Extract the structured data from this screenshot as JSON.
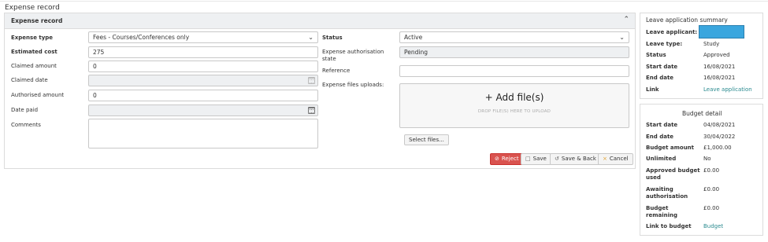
{
  "page": {
    "title": "Expense record"
  },
  "panel": {
    "title": "Expense record",
    "collapse_icon": "chevron-up-icon"
  },
  "form": {
    "expense_type": {
      "label": "Expense type",
      "value": "Fees - Courses/Conferences only"
    },
    "estimated_cost": {
      "label": "Estimated cost",
      "value": "275"
    },
    "claimed_amount": {
      "label": "Claimed amount",
      "value": "0"
    },
    "claimed_date": {
      "label": "Claimed date",
      "value": ""
    },
    "authorised_amount": {
      "label": "Authorised amount",
      "value": "0"
    },
    "date_paid": {
      "label": "Date paid",
      "value": ""
    },
    "comments": {
      "label": "Comments",
      "value": ""
    },
    "status": {
      "label": "Status",
      "value": "Active"
    },
    "auth_state": {
      "label_line1": "Expense authorisation",
      "label_line2": "state",
      "value": "Pending"
    },
    "reference": {
      "label": "Reference",
      "value": ""
    },
    "uploads": {
      "label": "Expense files uploads:",
      "add_text": "+ Add file(s)",
      "drop_hint": "DROP FILE(S) HERE TO UPLOAD",
      "select_button": "Select files..."
    }
  },
  "actions": {
    "reject": "Reject",
    "save": "Save",
    "save_back": "Save & Back",
    "cancel": "Cancel"
  },
  "leave_summary": {
    "title": "Leave application summary",
    "rows": [
      {
        "label": "Leave applicant:",
        "value": ""
      },
      {
        "label": "Leave type:",
        "value": "Study"
      },
      {
        "label": "Status",
        "value": "Approved"
      },
      {
        "label": "Start date",
        "value": "16/08/2021"
      },
      {
        "label": "End date",
        "value": "16/08/2021"
      },
      {
        "label": "Link",
        "value": "Leave application"
      }
    ]
  },
  "budget": {
    "title": "Budget detail",
    "rows": [
      {
        "label": "Start date",
        "value": "04/08/2021"
      },
      {
        "label": "End date",
        "value": "30/04/2022"
      },
      {
        "label": "Budget amount",
        "value": "£1,000.00"
      },
      {
        "label": "Unlimited",
        "value": "No"
      },
      {
        "label_line1": "Approved budget",
        "label_line2": "used",
        "value": "£0.00"
      },
      {
        "label_line1": "Awaiting",
        "label_line2": "authorisation",
        "value": "£0.00"
      },
      {
        "label_line1": "Budget",
        "label_line2": "remaining",
        "value": "£0.00"
      },
      {
        "label": "Link to budget",
        "value": "Budget"
      }
    ]
  },
  "colors": {
    "reject": "#d9534f",
    "link": "#2a8a8f",
    "redaction": "#3aa6de"
  }
}
